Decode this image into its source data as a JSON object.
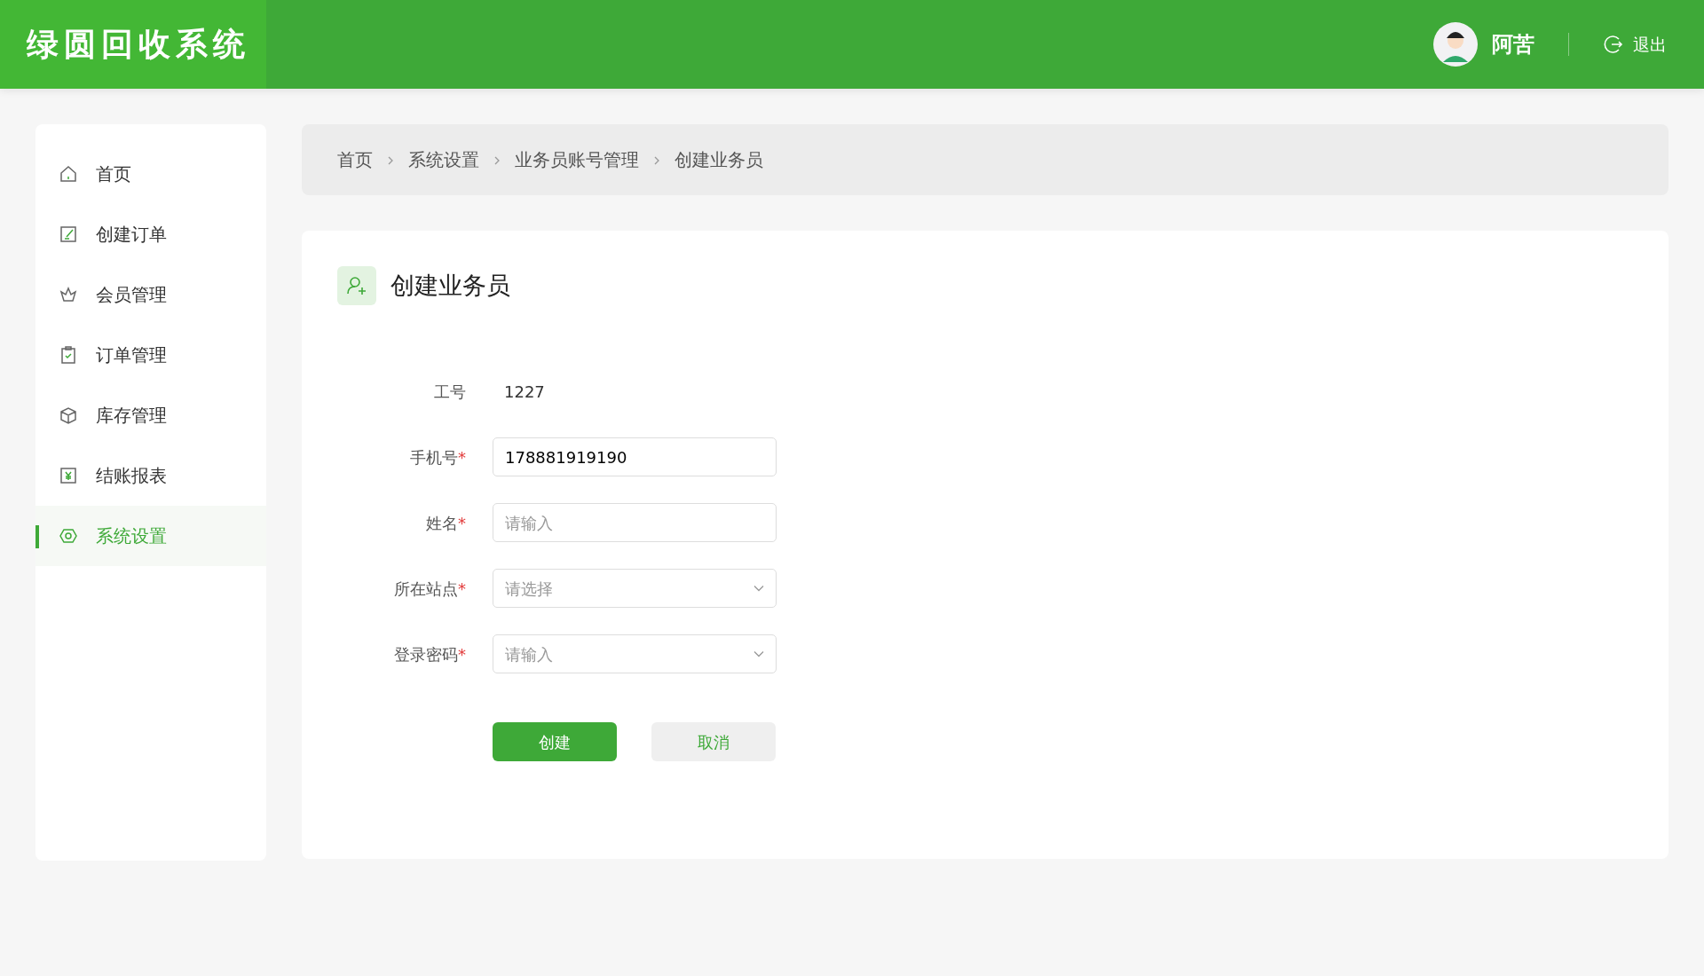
{
  "header": {
    "logo": "绿圆回收系统",
    "user_name": "阿苦",
    "logout": "退出"
  },
  "sidebar": {
    "items": [
      {
        "label": "首页",
        "selected": false
      },
      {
        "label": "创建订单",
        "selected": false
      },
      {
        "label": "会员管理",
        "selected": false
      },
      {
        "label": "订单管理",
        "selected": false
      },
      {
        "label": "库存管理",
        "selected": false
      },
      {
        "label": "结账报表",
        "selected": false
      },
      {
        "label": "系统设置",
        "selected": true
      }
    ]
  },
  "breadcrumb": [
    "首页",
    "系统设置",
    "业务员账号管理",
    "创建业务员"
  ],
  "form": {
    "title": "创建业务员",
    "fields": [
      {
        "kind": "static",
        "label": "工号",
        "value": "1227"
      },
      {
        "kind": "input",
        "label": "手机号",
        "required_mark": "*",
        "value": "178881919190"
      },
      {
        "kind": "input",
        "label": "姓名",
        "required_mark": "*",
        "placeholder": "请输入"
      },
      {
        "kind": "select",
        "label": "所在站点",
        "required_mark": "*",
        "placeholder": "请选择"
      },
      {
        "kind": "select",
        "label": "登录密码",
        "required_mark": "*",
        "placeholder": "请输入"
      }
    ],
    "buttons": [
      {
        "label": "创建",
        "kind": "primary"
      },
      {
        "label": "取消",
        "kind": "secondary"
      }
    ]
  }
}
